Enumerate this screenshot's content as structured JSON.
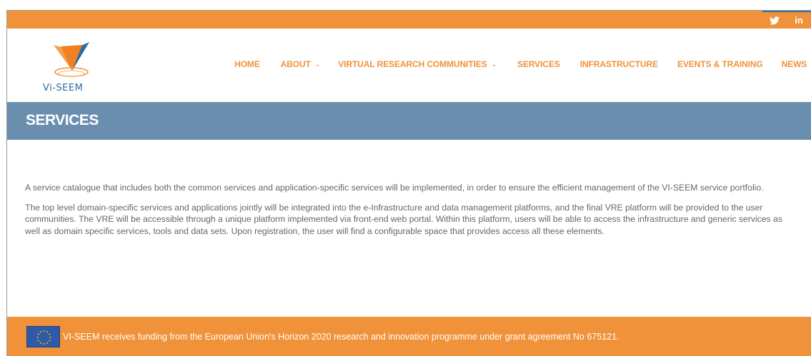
{
  "social": {
    "items": [
      {
        "name": "twitter",
        "icon": "twitter-icon"
      },
      {
        "name": "linkedin",
        "icon": "linkedin-icon",
        "label": "in"
      }
    ]
  },
  "logo": {
    "text": "Vi-SEEM"
  },
  "nav": {
    "items": [
      {
        "label": "HOME",
        "has_dropdown": false
      },
      {
        "label": "ABOUT",
        "has_dropdown": true
      },
      {
        "label": "VIRTUAL RESEARCH COMMUNITIES",
        "has_dropdown": true
      },
      {
        "label": "SERVICES",
        "has_dropdown": false
      },
      {
        "label": "INFRASTRUCTURE",
        "has_dropdown": false
      },
      {
        "label": "EVENTS & TRAINING",
        "has_dropdown": false
      },
      {
        "label": "NEWS",
        "has_dropdown": false
      }
    ]
  },
  "page": {
    "title": "SERVICES",
    "paragraphs": [
      "A service catalogue that includes both the common services and application-specific services will be implemented, in order to ensure the efficient management of the VI-SEEM service portfolio.",
      "The top level domain-specific services and applications jointly will be integrated into the e-Infrastructure and data management platforms, and the final VRE platform will be provided to the user communities. The VRE will be accessible through a unique platform implemented via front-end web portal. Within this platform, users will be able to access the infrastructure and generic services as well as domain specific services, tools and data sets. Upon registration, the user will find a configurable space that provides access all these elements."
    ]
  },
  "footer": {
    "flag_icon": "eu-flag-icon",
    "text": "VI-SEEM receives funding from the European Union's Horizon 2020 research and innovation programme under grant agreement No 675121."
  },
  "colors": {
    "accent_orange": "#f0923a",
    "title_bar": "#6a8fae",
    "logo_blue": "#2f6aa5",
    "body_text": "#666666"
  }
}
